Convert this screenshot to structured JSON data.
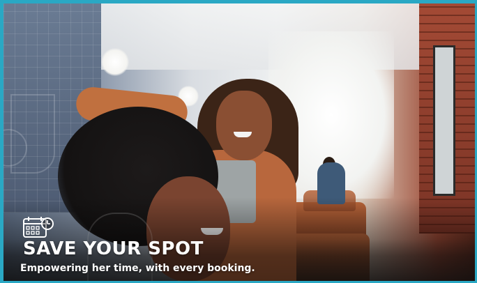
{
  "banner": {
    "headline": "SAVE YOUR SPOT",
    "subheadline": "Empowering her time, with every booking.",
    "icon": "calendar-clock-icon",
    "border_color": "#2aa8c4",
    "text_color": "#ffffff"
  }
}
